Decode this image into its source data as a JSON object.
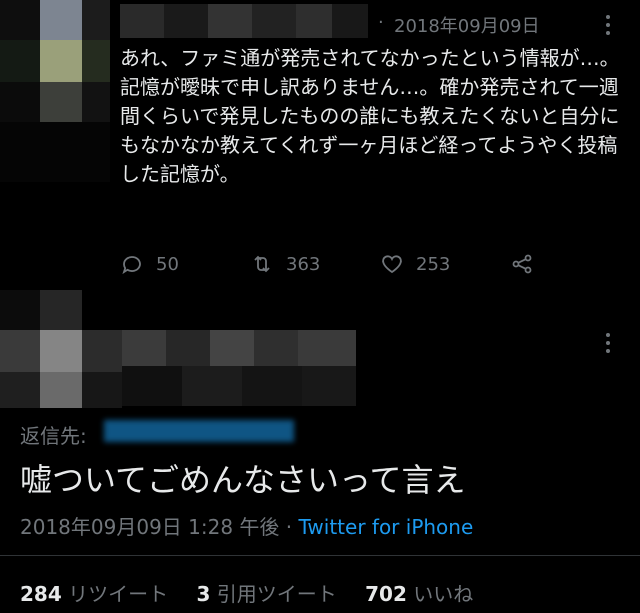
{
  "tweet1": {
    "timestamp": "2018年09月09日",
    "text": "あれ、ファミ通が発売されてなかったという情報が…。記憶が曖昧で申し訳ありません…。確か発売されて一週間くらいで発見したものの誰にも教えたくないと自分にもなかなか教えてくれず一ヶ月ほど経ってようやく投稿した記憶が。",
    "separator": "·",
    "replies": "50",
    "retweets": "363",
    "likes": "253",
    "icons": [
      "reply-icon",
      "retweet-icon",
      "like-icon",
      "share-icon",
      "more-icon"
    ]
  },
  "tweet2": {
    "reply_to_label": "返信先:",
    "text": "嘘ついてごめんなさいって言え",
    "timestamp": "2018年09月09日 1:28 午後",
    "separator": "·",
    "source": "Twitter for iPhone",
    "retweets_count": "284",
    "retweets_label": "リツイート",
    "quotes_count": "3",
    "quotes_label": "引用ツイート",
    "likes_count": "702",
    "likes_label": "いいね"
  },
  "colors": {
    "background": "#000000",
    "text": "#e7e9ea",
    "muted": "#71767b",
    "link": "#1d9bf0"
  }
}
